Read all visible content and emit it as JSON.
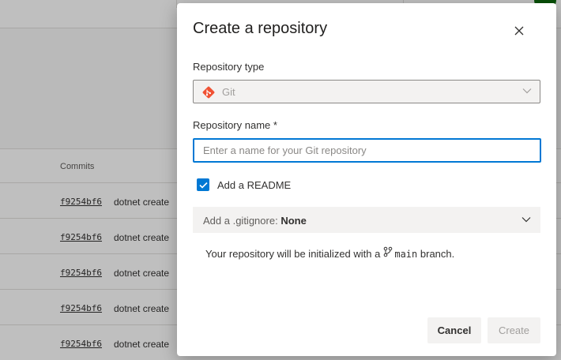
{
  "background": {
    "table": {
      "column_header": "Commits",
      "rows": [
        {
          "hash": "f9254bf6",
          "message": "dotnet create"
        },
        {
          "hash": "f9254bf6",
          "message": "dotnet create"
        },
        {
          "hash": "f9254bf6",
          "message": "dotnet create"
        },
        {
          "hash": "f9254bf6",
          "message": "dotnet create"
        },
        {
          "hash": "f9254bf6",
          "message": "dotnet create"
        }
      ]
    }
  },
  "dialog": {
    "title": "Create a repository",
    "close_icon": "close-icon",
    "repo_type": {
      "label": "Repository type",
      "value": "Git",
      "icon": "git-icon"
    },
    "repo_name": {
      "label": "Repository name *",
      "value": "",
      "placeholder": "Enter a name for your Git repository"
    },
    "readme": {
      "label": "Add a README",
      "checked": true
    },
    "gitignore": {
      "label": "Add a .gitignore:",
      "value": "None"
    },
    "info": {
      "text_before": "Your repository will be initialized with a",
      "branch": "main",
      "text_after": "branch."
    },
    "buttons": {
      "cancel": "Cancel",
      "create": "Create"
    }
  },
  "colors": {
    "accent": "#0078d4",
    "git_brand": "#f05133",
    "disabled_text": "#a19f9d"
  }
}
